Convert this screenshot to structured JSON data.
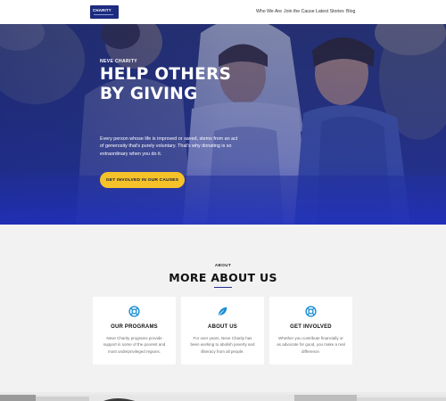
{
  "header": {
    "logo_text": "CHARITY",
    "nav": [
      "Who We Are",
      "Join the Cause",
      "Latest Stories",
      "Blog"
    ]
  },
  "hero": {
    "eyebrow": "NEVE CHARITY",
    "headline": "HELP OTHERS BY GIVING",
    "text": "Every person whose life is improved or saved, stems from an act of generosity that's purely voluntary. That's why donating is so extraordinary when you do it.",
    "cta": "GET INVOLVED IN OUR CAUSES"
  },
  "about": {
    "eyebrow": "ABOUT",
    "title": "MORE ABOUT US",
    "cards": [
      {
        "icon": "lifebuoy-icon",
        "title": "OUR PROGRAMS",
        "text": "Neve Charity programs provide support in some of the poorest and most underprivileged regions."
      },
      {
        "icon": "leaf-icon",
        "title": "ABOUT US",
        "text": "For over years, Neve Charity has been working to abolish poverty and illiteracy from all people."
      },
      {
        "icon": "lifebuoy-icon",
        "title": "GET INVOLVED",
        "text": "Whether you contribute financially or as advocate for good, you make a real difference."
      }
    ]
  },
  "colors": {
    "brand": "#1d2b80",
    "accent": "#f5c229",
    "icon": "#1a8fd6",
    "section_bg": "#f2f2f2"
  }
}
